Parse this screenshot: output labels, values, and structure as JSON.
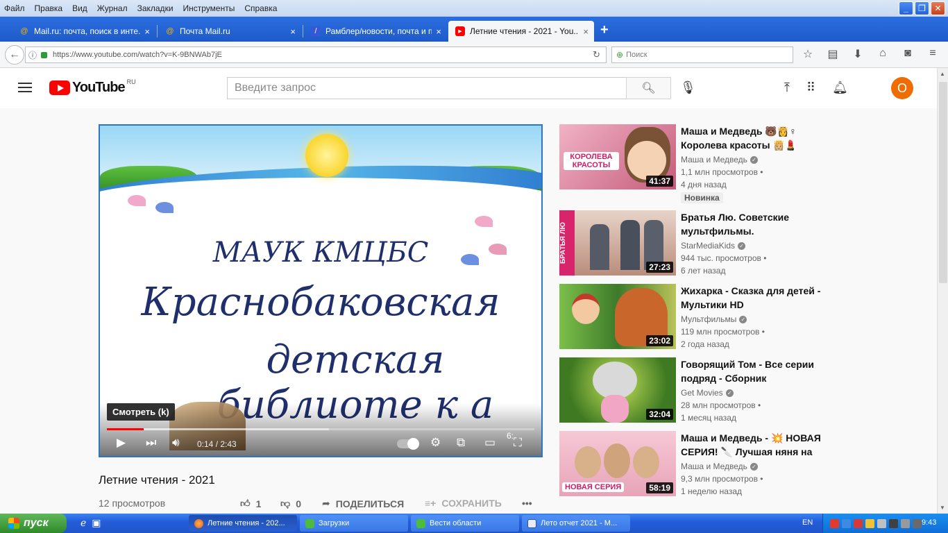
{
  "menu": [
    "Файл",
    "Правка",
    "Вид",
    "Журнал",
    "Закладки",
    "Инструменты",
    "Справка"
  ],
  "tabs": [
    {
      "label": "Mail.ru: почта, поиск в инте...",
      "icon": "@",
      "close": "×"
    },
    {
      "label": "Почта Mail.ru",
      "icon": "@",
      "close": "×"
    },
    {
      "label": "Рамблер/новости, почта и п...",
      "icon": "/",
      "close": "×"
    },
    {
      "label": "Летние чтения - 2021 - You...",
      "icon": "▶",
      "close": "×"
    }
  ],
  "new_tab": "+",
  "nav": {
    "url": "https://www.youtube.com/watch?v=K-9BNWAb7jE",
    "search_placeholder": "Поиск"
  },
  "youtube": {
    "logo_word": "YouTube",
    "logo_region": "RU",
    "search_placeholder": "Введите запрос",
    "avatar_letter": "O"
  },
  "player": {
    "slide_line1": "МАУК КМЦБС",
    "slide_line2": "Красно­баковская",
    "slide_line3": "детская библиоте к а",
    "tooltip": "Смотреть (k)",
    "time": "0:14 / 2:43",
    "progress_played": 0.086,
    "progress_buffered": 0.52,
    "corner_text": "6:"
  },
  "video": {
    "title": "Летние чтения - 2021",
    "views": "12 просмотров",
    "likes": "1",
    "dislikes": "0",
    "share": "ПОДЕЛИТЬСЯ",
    "save": "СОХРАНИТЬ",
    "more": "•••"
  },
  "recommendations": [
    {
      "title": "Маша и Медведь 🐻👸♀ Королева красоты 👸🏼💄",
      "channel": "Маша и Медведь",
      "views": "1,1 млн просмотров •",
      "age": "4 дня назад",
      "badge": "Новинка",
      "duration": "41:37",
      "thumb_text": "КОРОЛЕВА КРАСОТЫ"
    },
    {
      "title": "Братья Лю. Советские мультфильмы.",
      "channel": "StarMediaKids",
      "views": "944 тыс. просмотров •",
      "age": "6 лет назад",
      "duration": "27:23",
      "thumb_text": "БРАТЬЯ ЛЮ"
    },
    {
      "title": "Жихарка - Сказка для детей - Мультики HD",
      "channel": "Мультфильмы",
      "views": "119 млн просмотров •",
      "age": "2 года назад",
      "duration": "23:02"
    },
    {
      "title": "Говорящий Том - Все серии подряд - Сборник",
      "channel": "Get Movies",
      "views": "28 млн просмотров •",
      "age": "1 месяц назад",
      "duration": "32:04"
    },
    {
      "title": "Маша и Медведь - 💥 НОВАЯ СЕРИЯ! 🔪 Лучшая няня на",
      "channel": "Маша и Медведь",
      "views": "9,3 млн просмотров •",
      "age": "1 неделю назад",
      "duration": "58:19",
      "thumb_text": "НОВАЯ СЕРИЯ"
    }
  ],
  "taskbar": {
    "start": "пуск",
    "tasks": [
      "Летние чтения - 202...",
      "Загрузки",
      "Вести области",
      "Лето отчет 2021 - М..."
    ],
    "lang": "EN",
    "clock": "9:43"
  },
  "colors": {
    "youtube_red": "#ff0000",
    "tab_bar": "#1e5ac9",
    "avatar": "#ef6c00",
    "slide_text": "#1f2f6c"
  }
}
